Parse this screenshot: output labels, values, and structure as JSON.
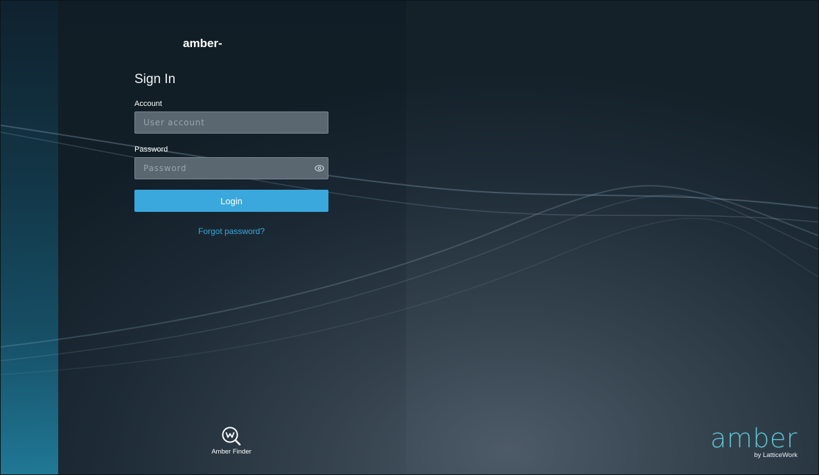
{
  "header": {
    "server_name": "amber-"
  },
  "signin": {
    "title": "Sign In",
    "account_label": "Account",
    "account_placeholder": "User account",
    "account_value": "",
    "password_label": "Password",
    "password_placeholder": "Password",
    "password_value": "",
    "login_label": "Login",
    "forgot_label": "Forgot password?"
  },
  "footer": {
    "finder_label": "Amber Finder",
    "finder_icon": "amber-finder-icon",
    "logo_word": "amber",
    "logo_sub": "by LatticeWork"
  },
  "colors": {
    "accent": "#3aa8dc",
    "logo": "#5cc2cf"
  },
  "icons": {
    "password_toggle": "eye-icon"
  }
}
